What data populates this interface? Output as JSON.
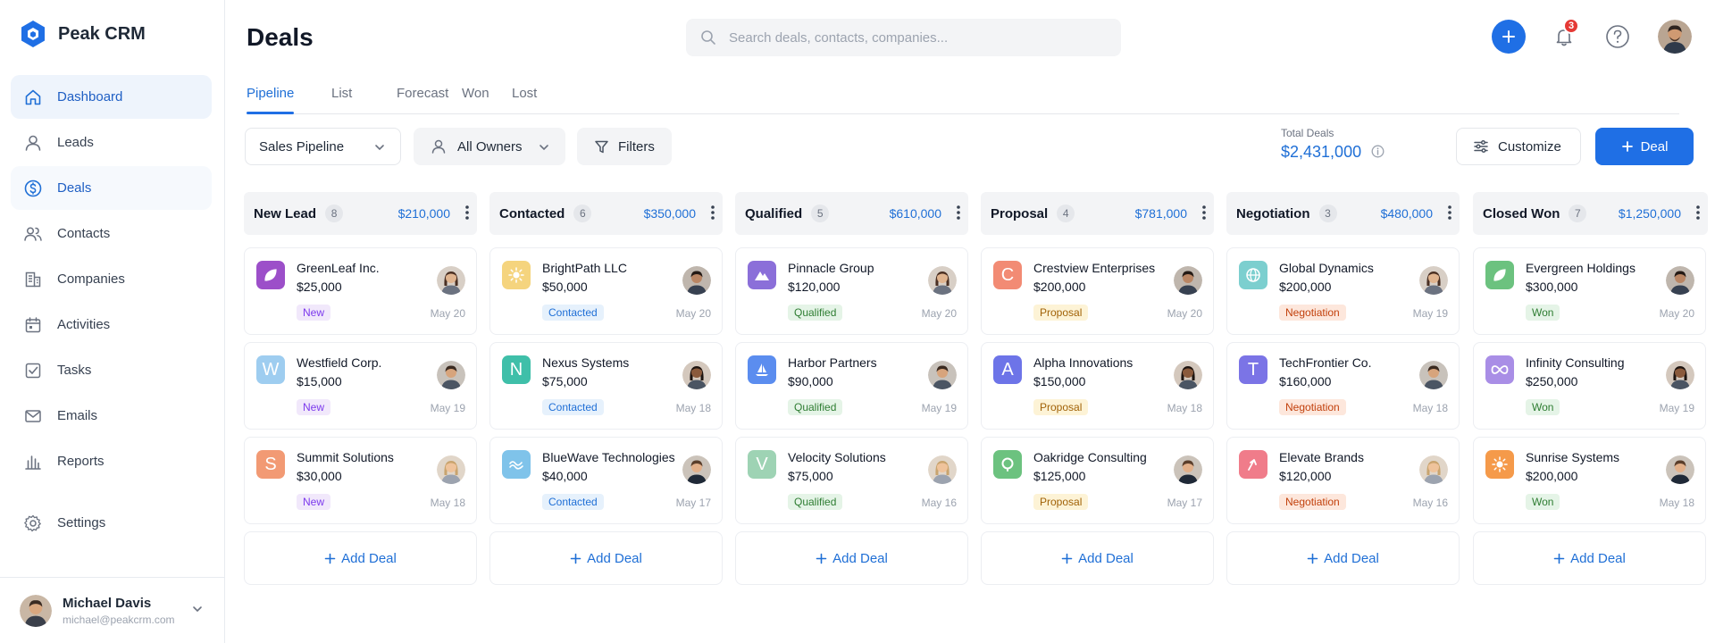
{
  "app": {
    "name": "Peak CRM"
  },
  "sidebar": {
    "items": [
      {
        "label": "Dashboard",
        "icon": "home-icon"
      },
      {
        "label": "Leads",
        "icon": "user-icon"
      },
      {
        "label": "Deals",
        "icon": "dollar-icon"
      },
      {
        "label": "Contacts",
        "icon": "users-icon"
      },
      {
        "label": "Companies",
        "icon": "building-icon"
      },
      {
        "label": "Activities",
        "icon": "calendar-icon"
      },
      {
        "label": "Tasks",
        "icon": "checkbox-icon"
      },
      {
        "label": "Emails",
        "icon": "mail-icon"
      },
      {
        "label": "Reports",
        "icon": "bar-chart-icon"
      },
      {
        "label": "Settings",
        "icon": "gear-icon"
      }
    ],
    "user": {
      "name": "Michael Davis",
      "email": "michael@peakcrm.com"
    }
  },
  "header": {
    "title": "Deals",
    "search_placeholder": "Search deals, contacts, companies...",
    "notifications": "3"
  },
  "tabs": [
    "Pipeline",
    "List",
    "Forecast",
    "Won",
    "Lost"
  ],
  "toolbar": {
    "pipeline": "Sales Pipeline",
    "owners": "All Owners",
    "filters": "Filters",
    "total_label": "Total Deals",
    "total_value": "$2,431,000",
    "customize": "Customize",
    "add_deal": "Deal"
  },
  "colors": {
    "accent": "#1f6fe5",
    "stage_new_bg": "#f1e8fb",
    "stage_new_fg": "#7c3aed",
    "stage_contacted_bg": "#e6f1fc",
    "stage_contacted_fg": "#1f6fd6",
    "stage_qualified_bg": "#e5f4e7",
    "stage_qualified_fg": "#2e7d32",
    "stage_proposal_bg": "#fdf3d6",
    "stage_proposal_fg": "#a16207",
    "stage_negotiation_bg": "#fde7dc",
    "stage_negotiation_fg": "#c2410c",
    "stage_won_bg": "#e5f4e7",
    "stage_won_fg": "#2e7d32"
  },
  "add_deal_label": "Add Deal",
  "columns": [
    {
      "name": "New Lead",
      "count": "8",
      "value": "$210,000",
      "stage": "new",
      "cards": [
        {
          "company": "GreenLeaf Inc.",
          "amount": "$25,000",
          "stage": "New",
          "date": "May 20",
          "icon": "leaf-icon",
          "icon_bg": "#9c4fc9"
        },
        {
          "company": "Westfield Corp.",
          "amount": "$15,000",
          "stage": "New",
          "date": "May 19",
          "icon": "letter-w-icon",
          "icon_bg": "#9ecdf0",
          "letter": "W"
        },
        {
          "company": "Summit Solutions",
          "amount": "$30,000",
          "stage": "New",
          "date": "May 18",
          "icon": "letter-s-icon",
          "icon_bg": "#f29a74",
          "letter": "S"
        }
      ]
    },
    {
      "name": "Contacted",
      "count": "6",
      "value": "$350,000",
      "stage": "contacted",
      "cards": [
        {
          "company": "BrightPath LLC",
          "amount": "$50,000",
          "stage": "Contacted",
          "date": "May 20",
          "icon": "sun-icon",
          "icon_bg": "#f5d47e"
        },
        {
          "company": "Nexus Systems",
          "amount": "$75,000",
          "stage": "Contacted",
          "date": "May 18",
          "icon": "letter-n-icon",
          "icon_bg": "#3fbfa9",
          "letter": "N"
        },
        {
          "company": "BlueWave Technologies",
          "amount": "$40,000",
          "stage": "Contacted",
          "date": "May 17",
          "icon": "wave-icon",
          "icon_bg": "#7fc3ea"
        }
      ]
    },
    {
      "name": "Qualified",
      "count": "5",
      "value": "$610,000",
      "stage": "qualified",
      "cards": [
        {
          "company": "Pinnacle Group",
          "amount": "$120,000",
          "stage": "Qualified",
          "date": "May 20",
          "icon": "mountain-icon",
          "icon_bg": "#8b6fd9"
        },
        {
          "company": "Harbor Partners",
          "amount": "$90,000",
          "stage": "Qualified",
          "date": "May 19",
          "icon": "sail-icon",
          "icon_bg": "#5b8def"
        },
        {
          "company": "Velocity Solutions",
          "amount": "$75,000",
          "stage": "Qualified",
          "date": "May 16",
          "icon": "letter-v-icon",
          "icon_bg": "#9ed3b4",
          "letter": "V"
        }
      ]
    },
    {
      "name": "Proposal",
      "count": "4",
      "value": "$781,000",
      "stage": "proposal",
      "cards": [
        {
          "company": "Crestview Enterprises",
          "amount": "$200,000",
          "stage": "Proposal",
          "date": "May 20",
          "icon": "letter-c-icon",
          "icon_bg": "#f28b74",
          "letter": "C"
        },
        {
          "company": "Alpha Innovations",
          "amount": "$150,000",
          "stage": "Proposal",
          "date": "May 18",
          "icon": "letter-a-icon",
          "icon_bg": "#6d74e8",
          "letter": "A"
        },
        {
          "company": "Oakridge Consulting",
          "amount": "$125,000",
          "stage": "Proposal",
          "date": "May 17",
          "icon": "bubble-icon",
          "icon_bg": "#6cc27f"
        }
      ]
    },
    {
      "name": "Negotiation",
      "count": "3",
      "value": "$480,000",
      "stage": "negotiation",
      "cards": [
        {
          "company": "Global Dynamics",
          "amount": "$200,000",
          "stage": "Negotiation",
          "date": "May 19",
          "icon": "globe-icon",
          "icon_bg": "#7ccfcf"
        },
        {
          "company": "TechFrontier Co.",
          "amount": "$160,000",
          "stage": "Negotiation",
          "date": "May 18",
          "icon": "letter-t-icon",
          "icon_bg": "#7b74e6",
          "letter": "T"
        },
        {
          "company": "Elevate Brands",
          "amount": "$120,000",
          "stage": "Negotiation",
          "date": "May 16",
          "icon": "arrow-up-icon",
          "icon_bg": "#f07c8a"
        }
      ]
    },
    {
      "name": "Closed Won",
      "count": "7",
      "value": "$1,250,000",
      "stage": "won",
      "cards": [
        {
          "company": "Evergreen Holdings",
          "amount": "$300,000",
          "stage": "Won",
          "date": "May 20",
          "icon": "leaf-icon",
          "icon_bg": "#6cc27f"
        },
        {
          "company": "Infinity Consulting",
          "amount": "$250,000",
          "stage": "Won",
          "date": "May 19",
          "icon": "infinity-icon",
          "icon_bg": "#a98ee6"
        },
        {
          "company": "Sunrise Systems",
          "amount": "$200,000",
          "stage": "Won",
          "date": "May 18",
          "icon": "sun-icon",
          "icon_bg": "#f59a4a"
        }
      ]
    }
  ]
}
